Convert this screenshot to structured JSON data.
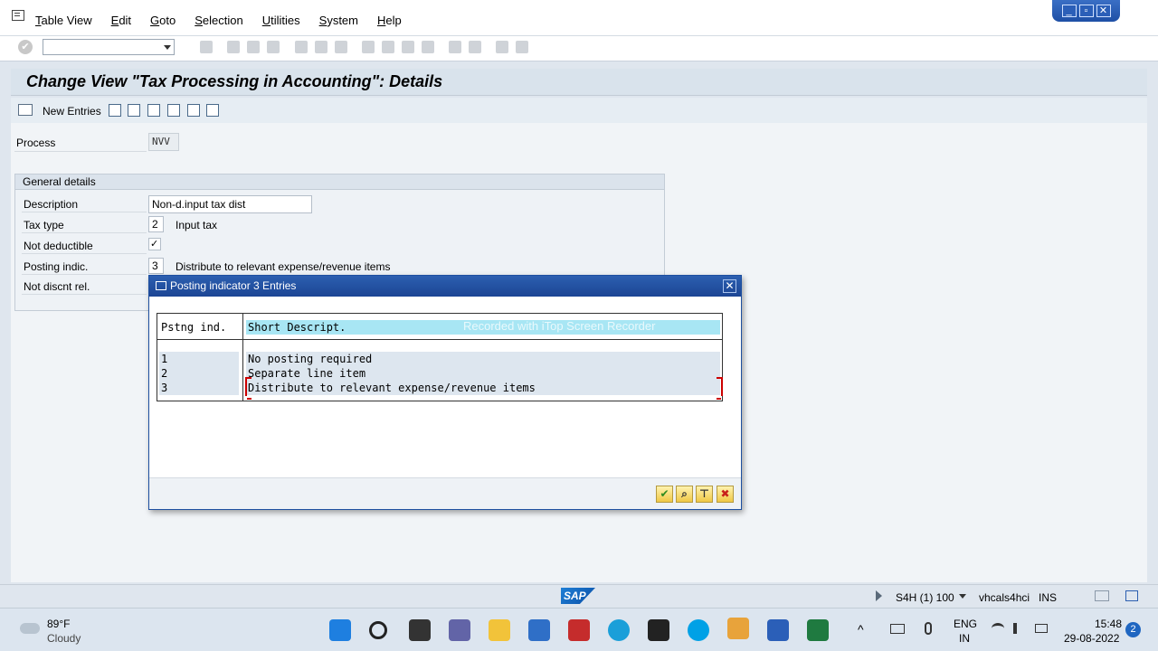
{
  "menu": {
    "items": [
      "Table View",
      "Edit",
      "Goto",
      "Selection",
      "Utilities",
      "System",
      "Help"
    ],
    "window_controls": [
      "_",
      "▫",
      "✕"
    ]
  },
  "toolbar": {
    "command_field": "",
    "enter_icon": "✔"
  },
  "title": "Change View \"Tax Processing in Accounting\": Details",
  "app_toolbar": {
    "new_entries": "New Entries"
  },
  "process": {
    "label": "Process",
    "value": "NVV"
  },
  "general": {
    "heading": "General details",
    "description_label": "Description",
    "description_value": "Non-d.input tax dist",
    "tax_type_label": "Tax type",
    "tax_type_value": "2",
    "tax_type_text": "Input tax",
    "not_deductible_label": "Not deductible",
    "not_deductible_value": "✓",
    "posting_indic_label": "Posting indic.",
    "posting_indic_value": "3",
    "posting_indic_text": "Distribute to relevant expense/revenue items",
    "not_discnt_label": "Not discnt rel."
  },
  "popup": {
    "title": "Posting indicator 3 Entries",
    "close": "✕",
    "col_ind": "Pstng ind.",
    "col_desc": "Short Descript.",
    "watermark": "Recorded with iTop Screen Recorder",
    "rows": [
      {
        "ind": "1",
        "desc": "No posting required"
      },
      {
        "ind": "2",
        "desc": "Separate line item"
      },
      {
        "ind": "3",
        "desc": "Distribute to relevant expense/revenue items"
      }
    ],
    "buttons": {
      "ok": "✔",
      "find": "⌕",
      "pin": "⊤",
      "cancel": "✖"
    }
  },
  "status": {
    "logo": "SAP",
    "system": "S4H (1) 100",
    "host": "vhcals4hci",
    "mode": "INS"
  },
  "taskbar": {
    "temp": "89°F",
    "weather": "Cloudy",
    "lang1": "ENG",
    "lang2": "IN",
    "time": "15:48",
    "date": "29-08-2022",
    "notifications": "2"
  }
}
